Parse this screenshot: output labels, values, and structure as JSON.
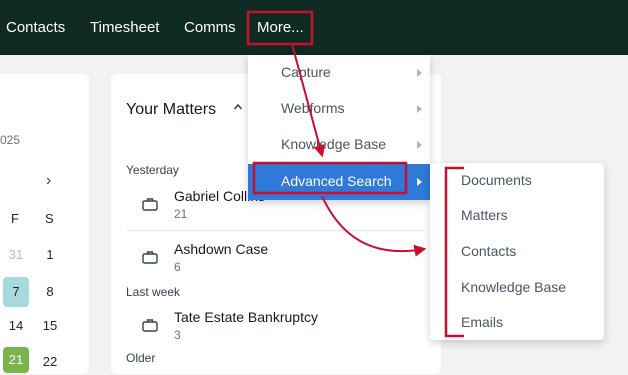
{
  "nav": {
    "contacts": "Contacts",
    "timesheet": "Timesheet",
    "comms": "Comms",
    "more": "More..."
  },
  "calendar": {
    "year_fragment": "025",
    "day_headers": [
      "F",
      "S"
    ],
    "rows": [
      [
        "31",
        "1"
      ],
      [
        "7",
        "8"
      ],
      [
        "14",
        "15"
      ],
      [
        "21",
        "22"
      ]
    ]
  },
  "matters": {
    "title": "Your Matters",
    "groups": {
      "yesterday": "Yesterday",
      "last_week": "Last week",
      "older": "Older"
    },
    "items": [
      {
        "name": "Gabriel Collins",
        "count": "21"
      },
      {
        "name": "Ashdown Case",
        "count": "6"
      },
      {
        "name": "Tate Estate Bankruptcy",
        "count": "3"
      }
    ]
  },
  "more_menu": {
    "items": [
      "Capture",
      "Webforms",
      "Knowledge Base",
      "Advanced Search"
    ],
    "active_index": 3
  },
  "advanced_search_menu": {
    "items": [
      "Documents",
      "Matters",
      "Contacts",
      "Knowledge Base",
      "Emails"
    ]
  },
  "colors": {
    "topbar": "#0e2a22",
    "highlight": "#2f79d8",
    "annotation": "#c8102e",
    "selected_day": "#a8dadc",
    "green_day": "#7ab64e"
  }
}
